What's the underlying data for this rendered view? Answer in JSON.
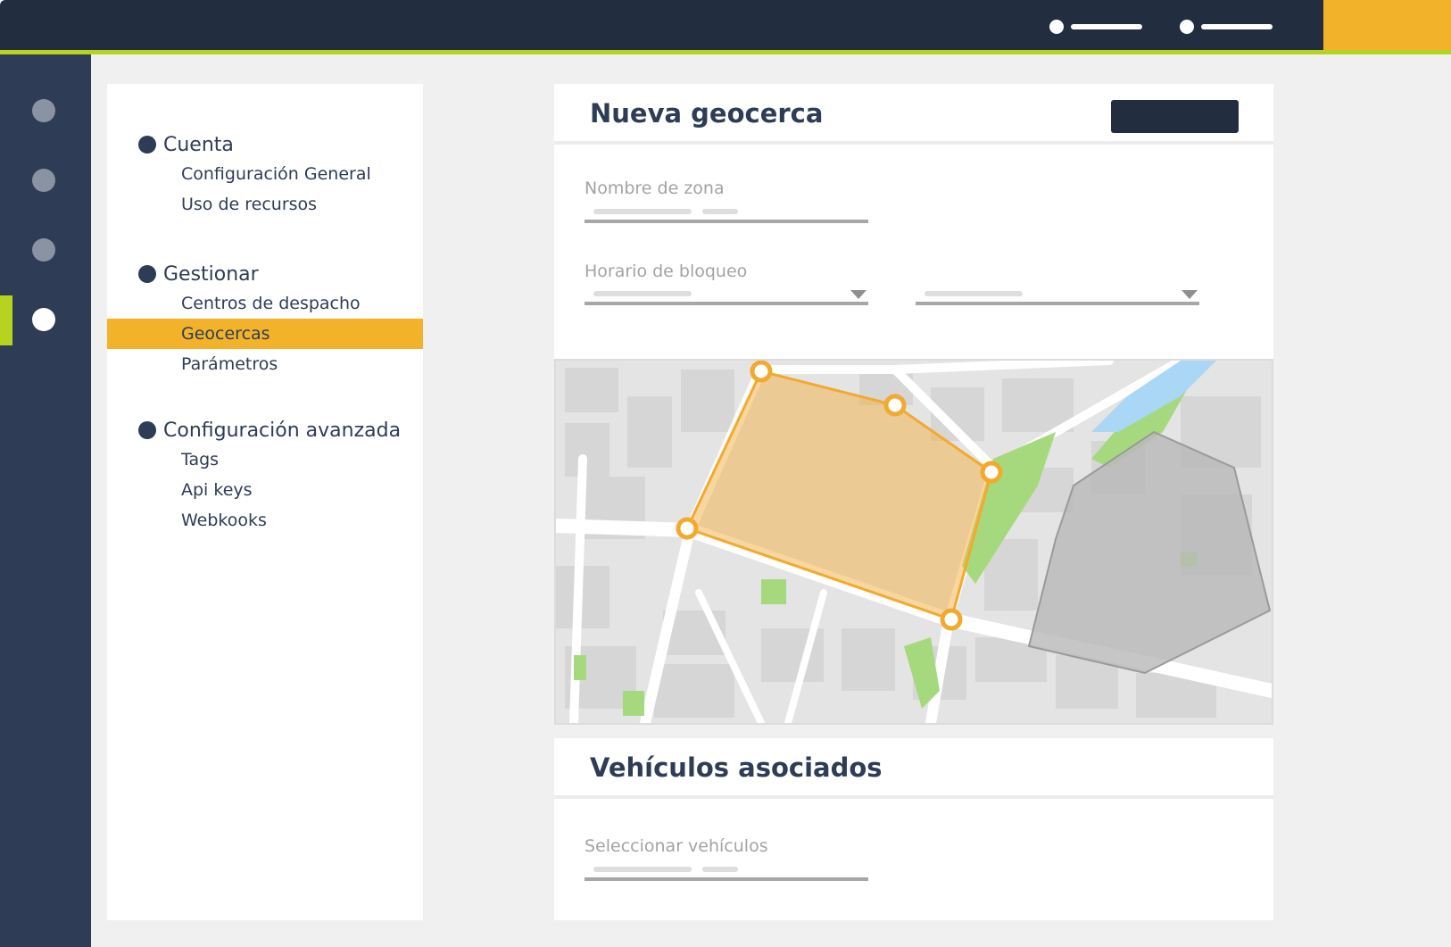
{
  "colors": {
    "navy": "#232d40",
    "rail": "#2e3c56",
    "accent_green": "#b6d320",
    "accent_yellow": "#f2b32b",
    "content_bg": "#f0f0f0",
    "muted_text": "#a3a3a3"
  },
  "menu": {
    "sections": [
      {
        "label": "Cuenta",
        "items": [
          "Configuración General",
          "Uso de recursos"
        ]
      },
      {
        "label": "Gestionar",
        "items": [
          "Centros de despacho",
          "Geocercas",
          "Parámetros"
        ]
      },
      {
        "label": "Configuración avanzada",
        "items": [
          "Tags",
          "Api keys",
          "Webkooks"
        ]
      }
    ],
    "active_item": "Geocercas"
  },
  "geofence_form": {
    "title": "Nueva geocerca",
    "zone_name_label": "Nombre de zona",
    "block_schedule_label": "Horario de bloqueo"
  },
  "vehicles": {
    "title": "Vehículos asociados",
    "select_label": "Seleccionar vehículos"
  },
  "icons": {
    "rail": [
      "nav-dot-icon",
      "nav-dot-icon",
      "nav-dot-icon",
      "nav-dot-icon"
    ],
    "dropdown": "caret-down-icon"
  }
}
